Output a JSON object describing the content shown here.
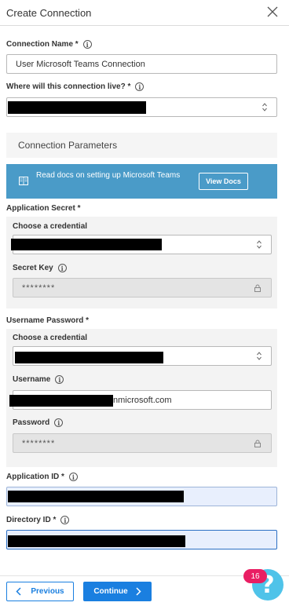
{
  "header": {
    "title": "Create Connection"
  },
  "connection_name": {
    "label": "Connection Name *",
    "value": "User Microsoft Teams Connection"
  },
  "location": {
    "label": "Where will this connection live? *"
  },
  "parameters": {
    "title": "Connection Parameters"
  },
  "docs": {
    "text": "Read docs on setting up Microsoft Teams",
    "button": "View Docs"
  },
  "app_secret": {
    "label": "Application Secret *",
    "choose_label": "Choose a credential",
    "secret_key_label": "Secret Key",
    "secret_key_value": "********"
  },
  "username_password": {
    "label": "Username Password *",
    "choose_label": "Choose a credential",
    "username_label": "Username",
    "username_suffix": "nmicrosoft.com",
    "password_label": "Password",
    "password_value": "********"
  },
  "application_id": {
    "label": "Application ID *"
  },
  "directory_id": {
    "label": "Directory ID *"
  },
  "footer": {
    "previous": "Previous",
    "continue": "Continue"
  },
  "help": {
    "badge": "16",
    "icon": "?"
  }
}
